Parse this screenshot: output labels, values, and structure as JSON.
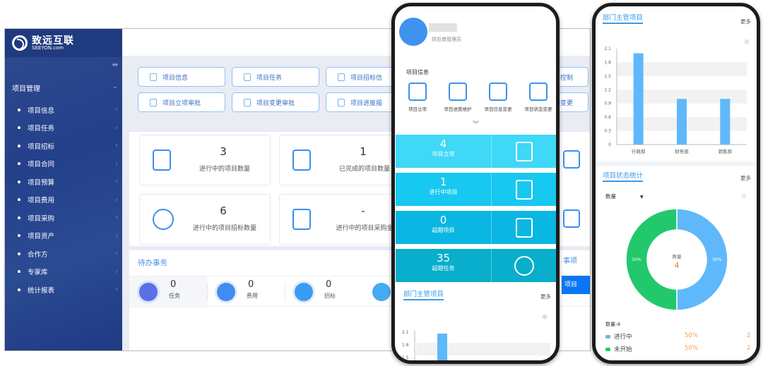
{
  "desktop": {
    "logo": {
      "name": "致远互联",
      "domain": "SEEYON.com"
    },
    "sidebar": {
      "group_label": "项目管理",
      "items": [
        "项目信息",
        "项目任务",
        "项目招标",
        "项目合同",
        "项目预算",
        "项目费用",
        "项目采购",
        "项目资产",
        "合作方",
        "专家库",
        "统计报表"
      ]
    },
    "quick_buttons": [
      {
        "label": "项目信息",
        "icon": "info-doc-icon"
      },
      {
        "label": "项目任务",
        "icon": "task-doc-icon"
      },
      {
        "label": "项目招标信",
        "icon": "gavel-icon"
      },
      {
        "label": "项目立项审批",
        "icon": "approval-doc-icon"
      },
      {
        "label": "项目变更审批",
        "icon": "change-doc-icon"
      },
      {
        "label": "项目进度报",
        "icon": "calendar-icon"
      }
    ],
    "partial_buttons": [
      "算控制",
      "划变更"
    ],
    "stat_cards": [
      {
        "value": "3",
        "label": "进行中的项目数量",
        "icon": "doc-refresh-icon"
      },
      {
        "value": "1",
        "label": "已完成的项目数量",
        "icon": "doc-check-icon"
      },
      {
        "value": "6",
        "label": "进行中的项目招标数量",
        "icon": "gavel-circle-icon"
      },
      {
        "value": "-",
        "label": "进行中的项目采购金",
        "icon": "box-money-icon"
      }
    ],
    "todo": {
      "title": "待办事务",
      "items": [
        {
          "value": "0",
          "label": "任务",
          "color": "#5b6fe6"
        },
        {
          "value": "0",
          "label": "费用",
          "color": "#3f8df0"
        },
        {
          "value": "0",
          "label": "招标",
          "color": "#3a9cf0"
        }
      ],
      "partial_title": "事项",
      "partial_button": "项目"
    }
  },
  "phone1": {
    "user_role": "供应商管理员",
    "section_title": "项目信息",
    "quick_items": [
      "项目立项",
      "项目进度维护",
      "项目信息变更",
      "项目状态变更"
    ],
    "tiles": [
      {
        "value": "4",
        "label": "项目立项",
        "color": "#3fd8f6"
      },
      {
        "value": "1",
        "label": "进行中项目",
        "color": "#17c8f0"
      },
      {
        "value": "0",
        "label": "超期项目",
        "color": "#0ab6e2"
      },
      {
        "value": "35",
        "label": "超期任务",
        "color": "#08aecb"
      }
    ],
    "dept_title": "部门主管项目",
    "more": "更多",
    "ticks": [
      "2.1",
      "1.8",
      "1.5"
    ]
  },
  "phone2": {
    "dept_title": "部门主管项目",
    "status_title": "项目状态统计",
    "more": "更多",
    "dropdown": "数量",
    "center_label": "数量",
    "center_value": "4",
    "total_label": "数量:4",
    "legend": [
      {
        "name": "进行中",
        "pct": "50%",
        "count": "2",
        "color": "#5fb8fb"
      },
      {
        "name": "未开始",
        "pct": "50%",
        "count": "2",
        "color": "#22c86c"
      }
    ]
  },
  "chart_data": [
    {
      "type": "bar",
      "title": "部门主管项目",
      "categories": [
        "行政部",
        "财务部",
        "销售部"
      ],
      "values": [
        2,
        1,
        1
      ],
      "ylim": [
        0,
        2.1
      ],
      "yticks": [
        "0",
        "0.3",
        "0.6",
        "0.9",
        "1.2",
        "1.5",
        "1.8",
        "2.1"
      ],
      "color": "#5fb8fb",
      "grid": "banded"
    },
    {
      "type": "pie",
      "title": "项目状态统计",
      "categories": [
        "进行中",
        "未开始"
      ],
      "values": [
        2,
        2
      ],
      "percent_labels": [
        "50%",
        "50%"
      ],
      "center": {
        "label": "数量",
        "value": "4"
      },
      "colors": [
        "#5fb8fb",
        "#22c86c"
      ]
    }
  ]
}
